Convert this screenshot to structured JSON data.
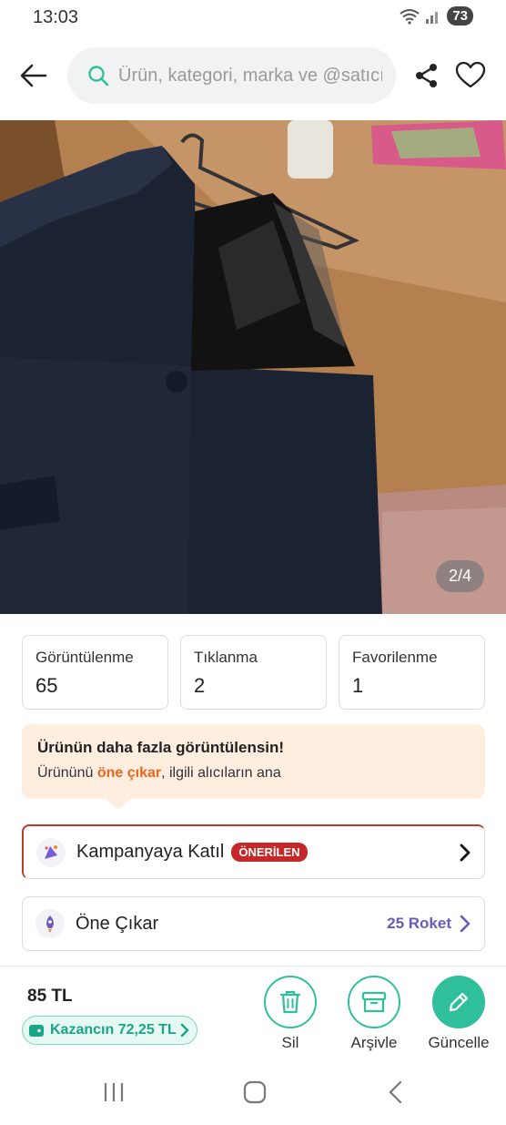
{
  "status_bar": {
    "time": "13:03",
    "battery": "73"
  },
  "search": {
    "placeholder": "Ürün, kategori, marka ve @satıcı"
  },
  "photo": {
    "counter": "2/4"
  },
  "stats": [
    {
      "label": "Görüntülenme",
      "value": "65"
    },
    {
      "label": "Tıklanma",
      "value": "2"
    },
    {
      "label": "Favorilenme",
      "value": "1"
    }
  ],
  "promo": {
    "title": "Ürünün daha fazla görüntülensin!",
    "text_before": "Ürününü ",
    "highlight": "öne çıkar",
    "text_after": ", ilgili alıcıların ana"
  },
  "campaign_row": {
    "label": "Kampanyaya Katıl",
    "badge": "ÖNERİLEN"
  },
  "featured_row": {
    "label": "Öne Çıkar",
    "rockets": "25 Roket"
  },
  "bottom": {
    "price": "85 TL",
    "earnings": "Kazancın 72,25 TL",
    "actions": {
      "delete": "Sil",
      "archive": "Arşivle",
      "update": "Güncelle"
    }
  },
  "colors": {
    "accent": "#2fbf9a",
    "promo_bg": "#fdeee0",
    "highlight": "#f0641e",
    "badge": "#c62828",
    "rocket": "#6b5bb8"
  }
}
